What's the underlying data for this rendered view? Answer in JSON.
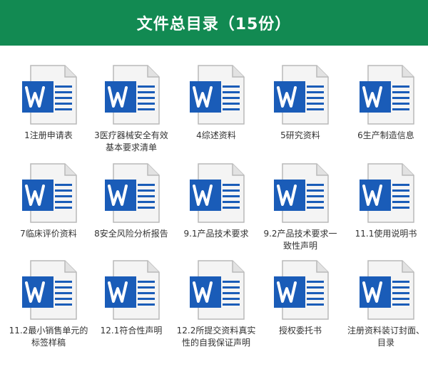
{
  "header": {
    "title": "文件总目录（15份）"
  },
  "colors": {
    "header_bg": "#128a52",
    "word_blue": "#1a5cb8",
    "word_blue_light": "#2b6fd0"
  },
  "files": [
    {
      "label": "1注册申请表",
      "icon": "word-doc-icon"
    },
    {
      "label": "3医疗器械安全有效基本要求清单",
      "icon": "word-doc-icon"
    },
    {
      "label": "4综述资料",
      "icon": "word-doc-icon"
    },
    {
      "label": "5研究资料",
      "icon": "word-doc-icon"
    },
    {
      "label": "6生产制造信息",
      "icon": "word-doc-icon"
    },
    {
      "label": "7临床评价资料",
      "icon": "word-doc-icon"
    },
    {
      "label": "8安全风险分析报告",
      "icon": "word-doc-icon"
    },
    {
      "label": "9.1产品技术要求",
      "icon": "word-doc-icon"
    },
    {
      "label": "9.2产品技术要求一致性声明",
      "icon": "word-doc-icon"
    },
    {
      "label": "11.1使用说明书",
      "icon": "word-doc-icon"
    },
    {
      "label": "11.2最小销售单元的标签样稿",
      "icon": "word-doc-icon"
    },
    {
      "label": "12.1符合性声明",
      "icon": "word-doc-icon"
    },
    {
      "label": "12.2所提交资料真实性的自我保证声明",
      "icon": "word-doc-icon"
    },
    {
      "label": "授权委托书",
      "icon": "word-doc-icon"
    },
    {
      "label": "注册资料装订封面、目录",
      "icon": "word-doc-icon"
    }
  ]
}
